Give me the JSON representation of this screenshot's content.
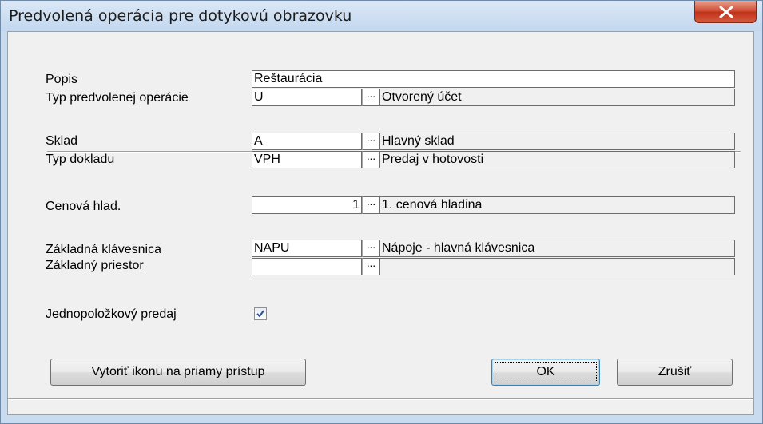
{
  "window": {
    "title": "Predvolená operácia pre dotykovú obrazovku"
  },
  "form": {
    "popis": {
      "label": "Popis",
      "value": "Reštaurácia"
    },
    "typ_operacie": {
      "label": "Typ predvolenej operácie",
      "value": "U",
      "description": "Otvorený účet"
    },
    "sklad": {
      "label": "Sklad",
      "value": "A",
      "description": "Hlavný sklad"
    },
    "typ_dokladu": {
      "label": "Typ dokladu",
      "value": "VPH",
      "description": "Predaj v hotovosti"
    },
    "cenova_hladina": {
      "label": "Cenová hlad.",
      "value": "1",
      "description": "1. cenová hladina"
    },
    "zakladna_klavesnica": {
      "label": "Základná klávesnica",
      "value": "NAPU",
      "description": "Nápoje - hlavná klávesnica"
    },
    "zakladny_priestor": {
      "label": "Základný priestor",
      "value": "",
      "description": ""
    },
    "jednopolozkovy_predaj": {
      "label": "Jednopoložkový predaj",
      "checked": true
    },
    "lookup_button": "···"
  },
  "buttons": {
    "shortcut": "Vytoriť ikonu na priamy prístup",
    "ok": "OK",
    "cancel": "Zrušiť"
  }
}
